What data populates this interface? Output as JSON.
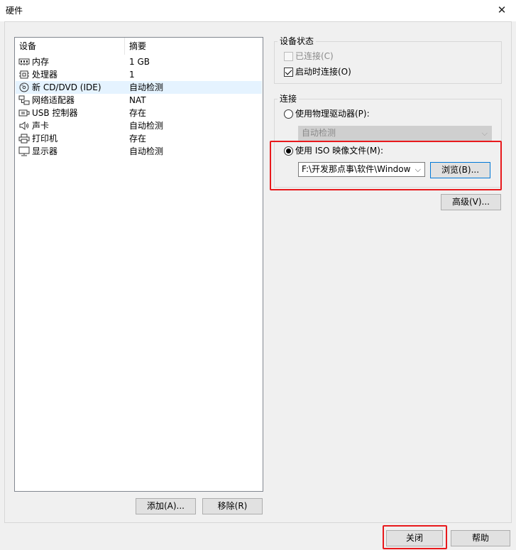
{
  "window": {
    "title": "硬件",
    "close_glyph": "✕"
  },
  "devices": {
    "headers": {
      "device": "设备",
      "summary": "摘要"
    },
    "rows": [
      {
        "name": "内存",
        "summary": "1 GB",
        "icon": "memory-icon"
      },
      {
        "name": "处理器",
        "summary": "1",
        "icon": "cpu-icon"
      },
      {
        "name": "新 CD/DVD (IDE)",
        "summary": "自动检测",
        "icon": "cd-dvd-icon",
        "selected": true
      },
      {
        "name": "网络适配器",
        "summary": "NAT",
        "icon": "network-adapter-icon"
      },
      {
        "name": "USB 控制器",
        "summary": "存在",
        "icon": "usb-icon"
      },
      {
        "name": "声卡",
        "summary": "自动检测",
        "icon": "sound-card-icon"
      },
      {
        "name": "打印机",
        "summary": "存在",
        "icon": "printer-icon"
      },
      {
        "name": "显示器",
        "summary": "自动检测",
        "icon": "monitor-icon"
      }
    ],
    "add_label": "添加(A)...",
    "remove_label": "移除(R)"
  },
  "device_status": {
    "title": "设备状态",
    "connected_label": "已连接(C)",
    "connected_checked": false,
    "connected_enabled": false,
    "connect_at_power_on_label": "启动时连接(O)",
    "connect_at_power_on_checked": true
  },
  "connection": {
    "title": "连接",
    "physical_drive_label": "使用物理驱动器(P):",
    "physical_drive_selected": false,
    "physical_drive_value": "自动检测",
    "iso_label": "使用 ISO 映像文件(M):",
    "iso_selected": true,
    "iso_path": "F:\\开发那点事\\软件\\Window",
    "browse_label": "浏览(B)..."
  },
  "advanced_label": "高级(V)...",
  "footer": {
    "close_label": "关闭",
    "help_label": "帮助"
  },
  "colors": {
    "highlight": "#e8191c",
    "selection": "#e5f3ff",
    "focus": "#0078d7"
  }
}
